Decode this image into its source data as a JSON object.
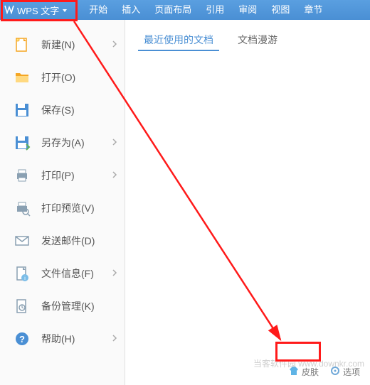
{
  "titlebar": {
    "app_label": "WPS 文字",
    "tabs": [
      "开始",
      "插入",
      "页面布局",
      "引用",
      "审阅",
      "视图",
      "章节"
    ]
  },
  "sidebar": {
    "items": [
      {
        "label": "新建(N)",
        "icon": "new-doc",
        "color": "#f5a623",
        "has_sub": true
      },
      {
        "label": "打开(O)",
        "icon": "folder",
        "color": "#f5a623",
        "has_sub": false
      },
      {
        "label": "保存(S)",
        "icon": "save",
        "color": "#4a8fd4",
        "has_sub": false
      },
      {
        "label": "另存为(A)",
        "icon": "save-as",
        "color": "#4a8fd4",
        "has_sub": true
      },
      {
        "label": "打印(P)",
        "icon": "print",
        "color": "#8aa0b2",
        "has_sub": true
      },
      {
        "label": "打印预览(V)",
        "icon": "print-preview",
        "color": "#8aa0b2",
        "has_sub": false
      },
      {
        "label": "发送邮件(D)",
        "icon": "mail",
        "color": "#8aa0b2",
        "has_sub": false
      },
      {
        "label": "文件信息(F)",
        "icon": "file-info",
        "color": "#8aa0b2",
        "has_sub": true
      },
      {
        "label": "备份管理(K)",
        "icon": "backup",
        "color": "#8aa0b2",
        "has_sub": false
      },
      {
        "label": "帮助(H)",
        "icon": "help",
        "color": "#4a8fd4",
        "has_sub": true
      }
    ]
  },
  "content": {
    "tabs": [
      {
        "label": "最近使用的文档",
        "active": true
      },
      {
        "label": "文档漫游",
        "active": false
      }
    ]
  },
  "footer": {
    "skin": "皮肤",
    "options": "选项"
  },
  "watermark": "当客软件园\nwww.downkr.com"
}
